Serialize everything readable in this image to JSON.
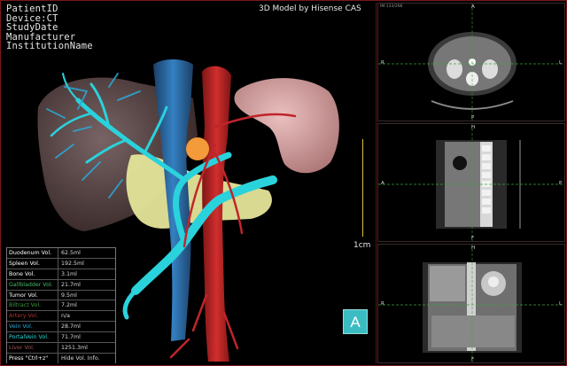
{
  "patient_info": {
    "patient_id": "PatientID",
    "device": "Device:CT",
    "study_date": "StudyDate",
    "manufacturer": "Manufacturer",
    "institution": "InstitutionName"
  },
  "model_title": "3D Model by Hisense CAS",
  "volume_table": [
    {
      "label": "Duodenum Vol.",
      "value": "62.5ml",
      "color": "#ffffff"
    },
    {
      "label": "Spleen Vol.",
      "value": "192.5ml",
      "color": "#ffffff"
    },
    {
      "label": "Bone Vol.",
      "value": "3.1ml",
      "color": "#ffffff"
    },
    {
      "label": "Gallbladder Vol.",
      "value": "21.7ml",
      "color": "#47b96b"
    },
    {
      "label": "Tumor Vol.",
      "value": "9.5ml",
      "color": "#ffffff"
    },
    {
      "label": "Biltract Vol.",
      "value": "7.2ml",
      "color": "#3c9a3c"
    },
    {
      "label": "Artery Vol.",
      "value": "n/a",
      "color": "#b03030"
    },
    {
      "label": "Vein Vol.",
      "value": "28.7ml",
      "color": "#2aa7d6"
    },
    {
      "label": "PortalVein Vol.",
      "value": "71.7ml",
      "color": "#2ad6d6"
    },
    {
      "label": "Liver Vol.",
      "value": "1251.3ml",
      "color": "#a05050"
    },
    {
      "label": "Press \"Ctrl+z\"",
      "value": "Hide Vol. Info.",
      "color": "#ffffff"
    }
  ],
  "scale_label": "1cm",
  "view_badge": "A",
  "slice_panels": {
    "axial": {
      "slice_info": "IM:133/266",
      "top": "A",
      "bottom": "P",
      "left": "R",
      "right": "L"
    },
    "sagittal": {
      "top": "H",
      "bottom": "F",
      "left": "A",
      "right": "P"
    },
    "coronal": {
      "top": "H",
      "bottom": "F",
      "left": "R",
      "right": "L"
    }
  },
  "colors": {
    "liver": "#7d6a6a",
    "spleen": "#d7a3a3",
    "gallbladder_region": "#e5e59a",
    "portal_vein": "#2ad2dc",
    "vein": "#2f6fa6",
    "artery": "#c0252a",
    "tumor": "#f39a3a",
    "crosshair": "#3ea23e"
  }
}
